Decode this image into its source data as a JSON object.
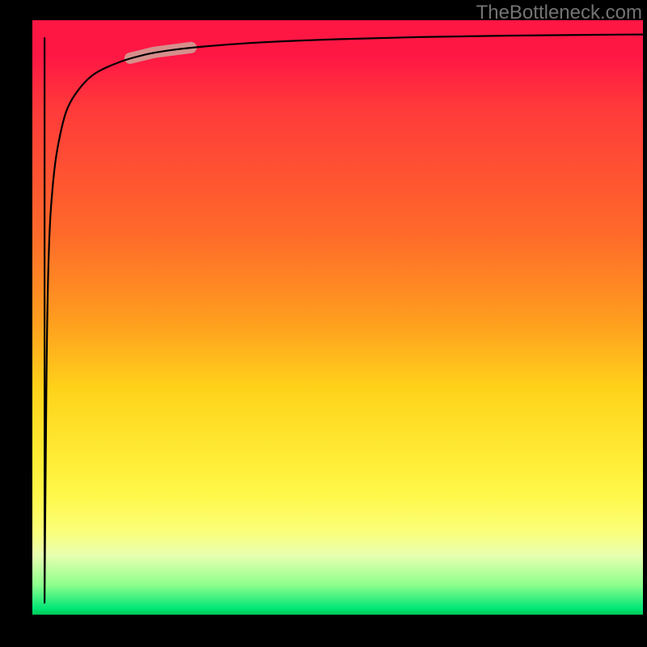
{
  "attribution": "TheBottleneck.com",
  "chart_data": {
    "type": "line",
    "title": "",
    "xlabel": "",
    "ylabel": "",
    "xlim": [
      0,
      100
    ],
    "ylim": [
      0,
      100
    ],
    "grid": false,
    "legend": false,
    "background_gradient": {
      "direction": "vertical",
      "stops": [
        {
          "pos": 0,
          "color": "#ff1744",
          "meaning": "worst"
        },
        {
          "pos": 50,
          "color": "#ffb300",
          "meaning": "mid"
        },
        {
          "pos": 80,
          "color": "#ffee58",
          "meaning": "near-good"
        },
        {
          "pos": 100,
          "color": "#00c853",
          "meaning": "best"
        }
      ]
    },
    "series": [
      {
        "name": "bottleneck-curve",
        "x": [
          2,
          2.2,
          2.4,
          2.6,
          2.8,
          3,
          3.5,
          4,
          5,
          6,
          8,
          10,
          13,
          16,
          20,
          26,
          34,
          44,
          56,
          70,
          85,
          100
        ],
        "y": [
          2,
          30,
          48,
          58,
          64,
          68,
          74,
          78,
          83,
          86,
          89,
          91,
          92.5,
          93.6,
          94.6,
          95.4,
          96.1,
          96.6,
          97,
          97.3,
          97.5,
          97.6
        ]
      }
    ],
    "highlight_segment": {
      "series": "bottleneck-curve",
      "x_range": [
        16,
        26
      ],
      "note": "emphasized band on curve"
    }
  }
}
